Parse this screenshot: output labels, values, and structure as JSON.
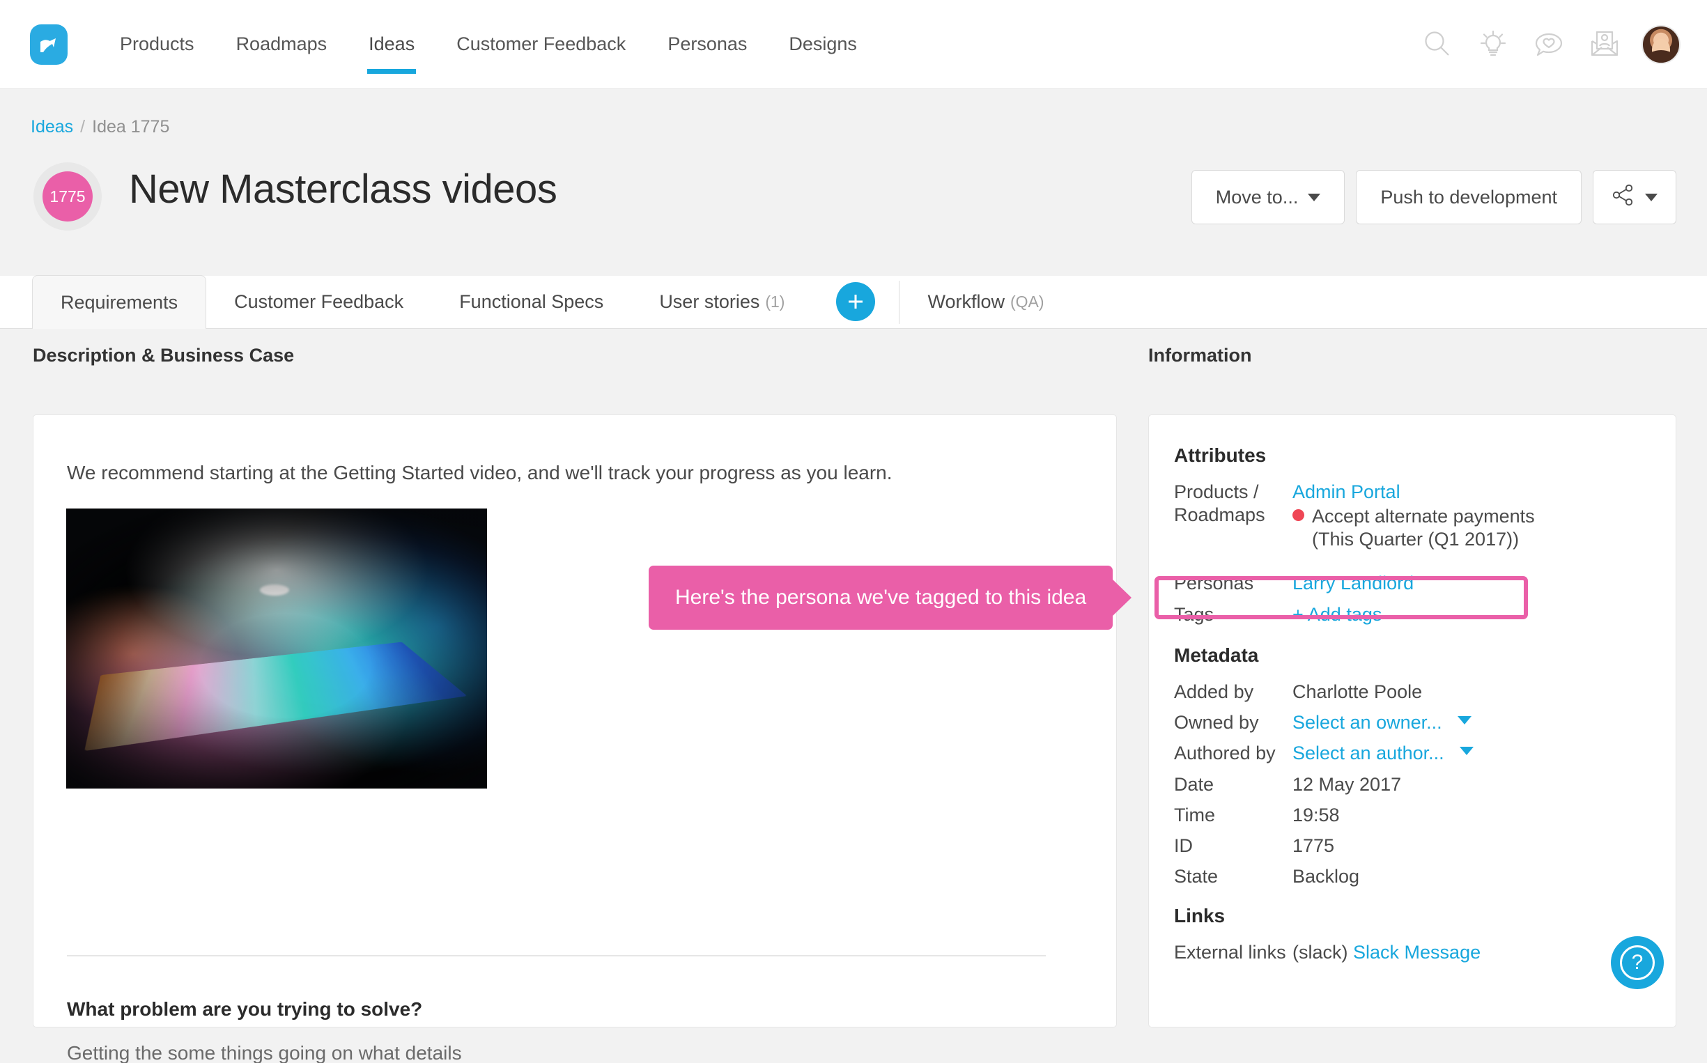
{
  "nav": {
    "logo_name": "prodpad-logo-icon",
    "items": [
      {
        "label": "Products",
        "active": false
      },
      {
        "label": "Roadmaps",
        "active": false
      },
      {
        "label": "Ideas",
        "active": true
      },
      {
        "label": "Customer Feedback",
        "active": false
      },
      {
        "label": "Personas",
        "active": false
      },
      {
        "label": "Designs",
        "active": false
      }
    ],
    "icons": [
      "search-icon",
      "lightbulb-icon",
      "chat-heart-icon",
      "envelope-contact-icon"
    ],
    "avatar": "user-avatar"
  },
  "breadcrumb": {
    "root": "Ideas",
    "separator": "/",
    "current": "Idea 1775"
  },
  "header": {
    "id_badge": "1775",
    "title": "New Masterclass videos",
    "actions": {
      "move_to": "Move to...",
      "push_to_development": "Push to development",
      "share": "share-icon"
    }
  },
  "tabs": [
    {
      "label": "Requirements",
      "count": "",
      "active": true
    },
    {
      "label": "Customer Feedback",
      "count": "",
      "active": false
    },
    {
      "label": "Functional Specs",
      "count": "",
      "active": false
    },
    {
      "label": "User stories",
      "count": "(1)",
      "active": false
    }
  ],
  "tab_add_label": "+",
  "workflow": {
    "label": "Workflow",
    "state": "(QA)"
  },
  "description": {
    "section_title": "Description & Business Case",
    "paragraph": "We recommend starting at the Getting Started video, and we'll track your progress as you learn.",
    "image_alt": "macbook-rainbow-glow-photo",
    "question_heading": "What problem are you trying to solve?",
    "question_clipped_text": "Getting the some things going on what details"
  },
  "callout": {
    "text": "Here's the persona we've tagged to this idea",
    "color": "#ea5fa8"
  },
  "information": {
    "section_title": "Information",
    "attributes": {
      "group_title": "Attributes",
      "products_roadmaps_label_line1": "Products /",
      "products_roadmaps_label_line2": "Roadmaps",
      "product": "Admin Portal",
      "roadmap": "Accept alternate payments",
      "roadmap_timeframe": "(This Quarter (Q1 2017))",
      "roadmap_dot_color": "#ef4655",
      "personas_label": "Personas",
      "personas_value": "Larry Landlord",
      "tags_label": "Tags",
      "tags_value": "+ Add tags"
    },
    "metadata": {
      "group_title": "Metadata",
      "rows": [
        {
          "label": "Added by",
          "value": "Charlotte Poole",
          "link": false,
          "dropdown": false
        },
        {
          "label": "Owned by",
          "value": "Select an owner...",
          "link": true,
          "dropdown": true
        },
        {
          "label": "Authored by",
          "value": "Select an author...",
          "link": true,
          "dropdown": true
        },
        {
          "label": "Date",
          "value": "12 May 2017",
          "link": false,
          "dropdown": false
        },
        {
          "label": "Time",
          "value": "19:58",
          "link": false,
          "dropdown": false
        },
        {
          "label": "ID",
          "value": "1775",
          "link": false,
          "dropdown": false
        },
        {
          "label": "State",
          "value": "Backlog",
          "link": false,
          "dropdown": false
        }
      ]
    },
    "links": {
      "group_title": "Links",
      "external_label": "External links",
      "external_prefix": "(slack)",
      "external_value": "Slack Message"
    }
  },
  "help": {
    "label": "?"
  },
  "colors": {
    "brand_blue": "#18a7dd",
    "accent_pink": "#ea5fa8",
    "status_red": "#ef4655",
    "page_bg": "#f2f2f2"
  }
}
